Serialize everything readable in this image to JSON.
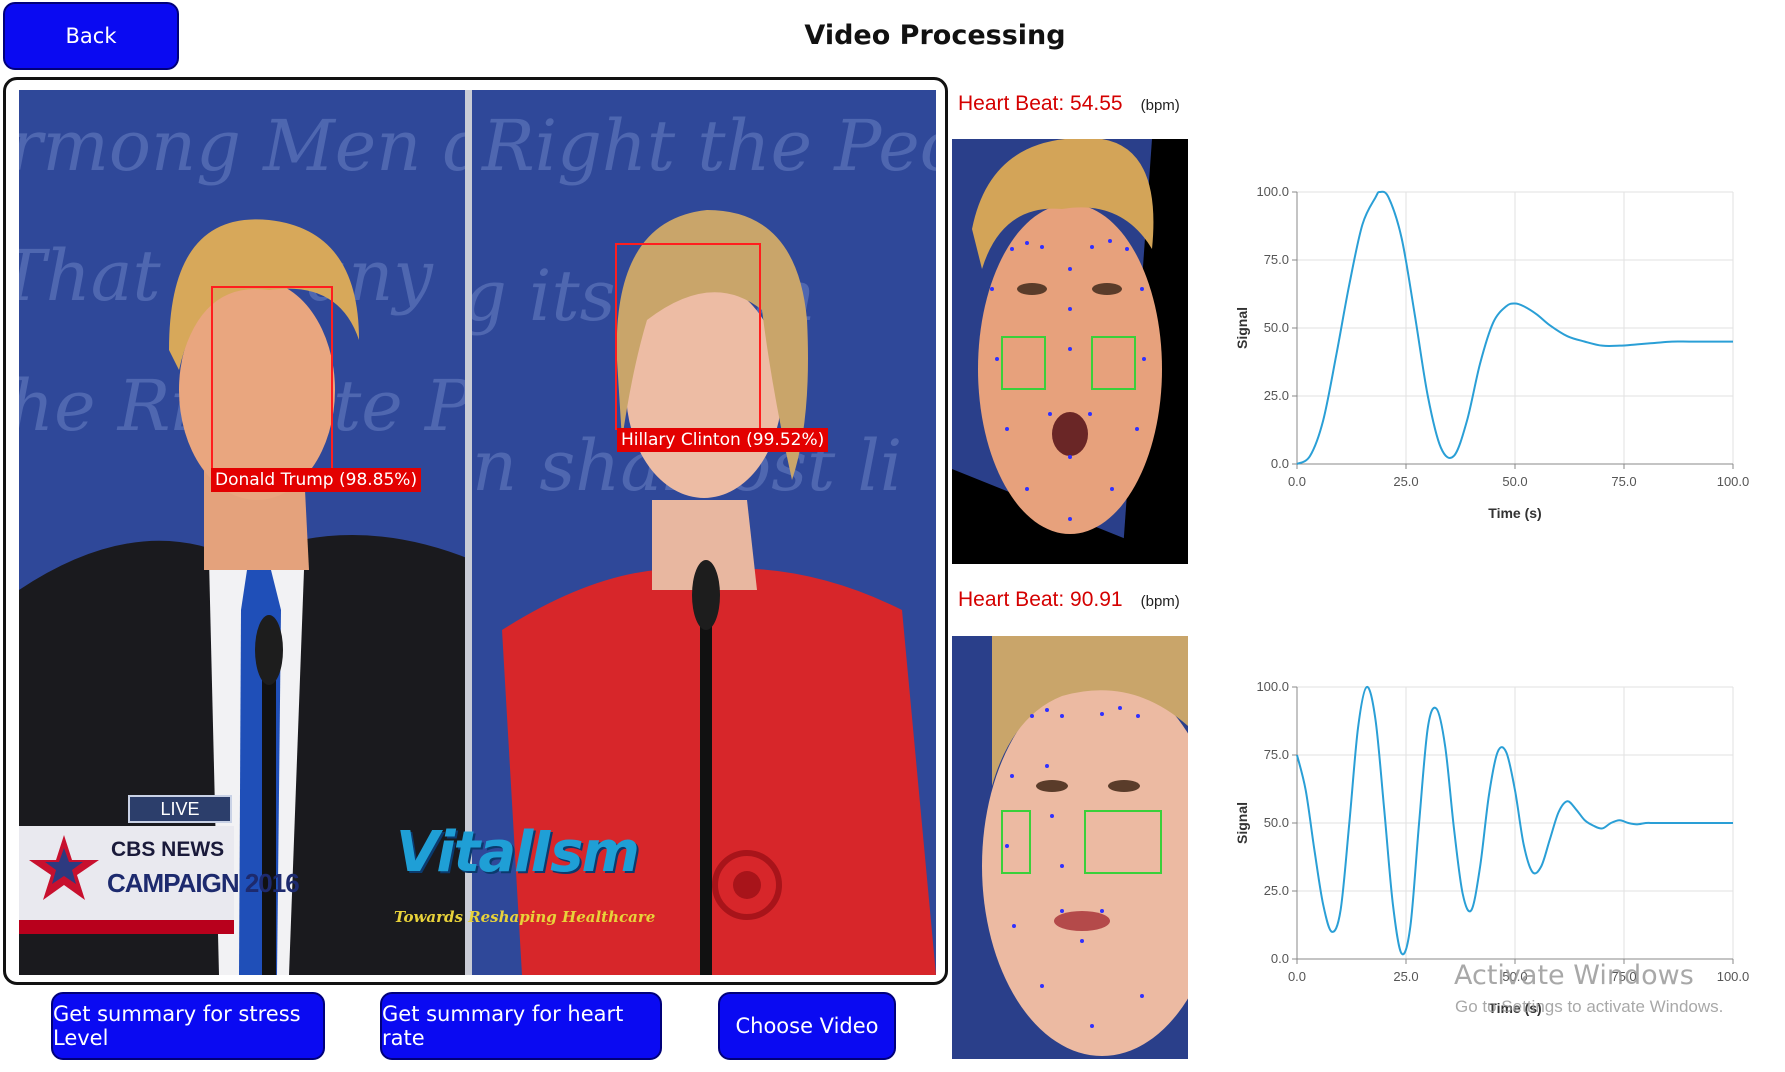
{
  "header": {
    "back_label": "Back",
    "title": "Video Processing"
  },
  "video": {
    "faces": [
      {
        "label": "Donald Trump (98.85%)"
      },
      {
        "label": "Hillary Clinton (99.52%)"
      }
    ],
    "overlay": {
      "live_badge": "LIVE",
      "network": "CBS NEWS",
      "campaign": "CAMPAIGN 2016",
      "logo_text": "VitalIsm",
      "logo_tagline": "Towards Reshaping Healthcare"
    }
  },
  "subjects": [
    {
      "heart_beat_label": "Heart Beat: 54.55",
      "unit": "(bpm)"
    },
    {
      "heart_beat_label": "Heart Beat: 90.91",
      "unit": "(bpm)"
    }
  ],
  "footer": {
    "stress_button": "Get summary for stress Level",
    "heart_button": "Get summary for heart rate",
    "choose_button": "Choose Video"
  },
  "watermark": {
    "title": "Activate Windows",
    "subtitle": "Go to Settings to activate Windows."
  },
  "chart_data": [
    {
      "type": "line",
      "xlabel": "Time (s)",
      "ylabel": "Signal",
      "xlim": [
        0,
        100
      ],
      "ylim": [
        0,
        100
      ],
      "x_ticks": [
        "0.0",
        "25.0",
        "50.0",
        "75.0",
        "100.0"
      ],
      "y_ticks": [
        "0.0",
        "25.0",
        "50.0",
        "75.0",
        "100.0"
      ],
      "grid": true,
      "line_color": "#2a9fd6",
      "series": [
        {
          "x": [
            0,
            3,
            6,
            9,
            12,
            15,
            18,
            19,
            21,
            24,
            27,
            30,
            33,
            36,
            39,
            42,
            45,
            48,
            50,
            52,
            55,
            58,
            62,
            66,
            70,
            74,
            78,
            82,
            86,
            90,
            95,
            100
          ],
          "y": [
            0,
            3,
            16,
            40,
            66,
            88,
            98,
            100,
            98,
            83,
            55,
            25,
            6,
            3,
            16,
            37,
            52,
            58,
            59,
            58,
            55,
            51,
            47,
            45,
            43.5,
            43.5,
            44,
            44.5,
            45,
            45,
            45,
            45
          ]
        }
      ]
    },
    {
      "type": "line",
      "xlabel": "Time (s)",
      "ylabel": "Signal",
      "xlim": [
        0,
        100
      ],
      "ylim": [
        0,
        100
      ],
      "x_ticks": [
        "0.0",
        "25.0",
        "50.0",
        "75.0",
        "100.0"
      ],
      "y_ticks": [
        "0.0",
        "25.0",
        "50.0",
        "75.0",
        "100.0"
      ],
      "grid": true,
      "line_color": "#2a9fd6",
      "series": [
        {
          "x": [
            0,
            2,
            4,
            6,
            8,
            10,
            12,
            14,
            16,
            18,
            20,
            22,
            24,
            26,
            28,
            30,
            32,
            34,
            36,
            38,
            40,
            42,
            44,
            46,
            48,
            50,
            52,
            54,
            56,
            58,
            60,
            62,
            64,
            66,
            68,
            70,
            72,
            74,
            76,
            78,
            80,
            82,
            86,
            90,
            95,
            100
          ],
          "y": [
            75,
            62,
            40,
            20,
            10,
            18,
            50,
            85,
            100,
            88,
            55,
            20,
            2,
            12,
            50,
            85,
            92,
            78,
            48,
            24,
            18,
            34,
            60,
            76,
            76,
            62,
            42,
            32,
            34,
            44,
            54,
            58,
            55,
            51,
            49,
            48,
            50,
            51,
            50,
            49.5,
            50,
            50,
            50,
            50,
            50,
            50
          ]
        }
      ]
    }
  ]
}
